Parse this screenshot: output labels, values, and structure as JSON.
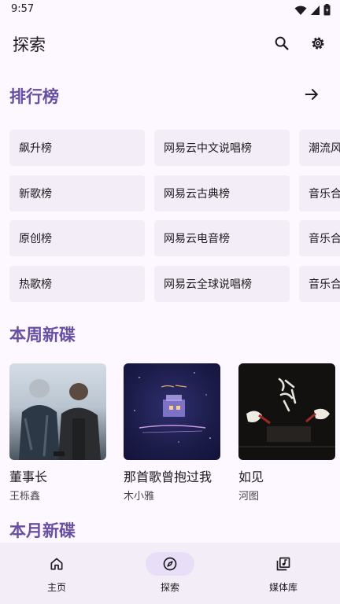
{
  "status": {
    "time": "9:57"
  },
  "header": {
    "title": "探索"
  },
  "sections": {
    "charts": "排行榜",
    "week": "本周新碟",
    "month": "本月新碟"
  },
  "charts": {
    "col1": [
      "飙升榜",
      "新歌榜",
      "原创榜",
      "热歌榜"
    ],
    "col2": [
      "网易云中文说唱榜",
      "网易云古典榜",
      "网易云电音榜",
      "网易云全球说唱榜"
    ],
    "col3": [
      "潮流风",
      "音乐合",
      "音乐合",
      "音乐合"
    ]
  },
  "albums": [
    {
      "title": "董事长",
      "artist": "王栎鑫"
    },
    {
      "title": "那首歌曾抱过我",
      "artist": "木小雅"
    },
    {
      "title": "如见",
      "artist": "河图"
    }
  ],
  "nav": [
    {
      "label": "主页",
      "icon": "home-icon"
    },
    {
      "label": "探索",
      "icon": "compass-icon"
    },
    {
      "label": "媒体库",
      "icon": "library-music-icon"
    }
  ],
  "colors": {
    "accent": "#6750a4",
    "background": "#fdf7ff",
    "surface": "#f3edf7",
    "indicator": "#e8def8"
  }
}
